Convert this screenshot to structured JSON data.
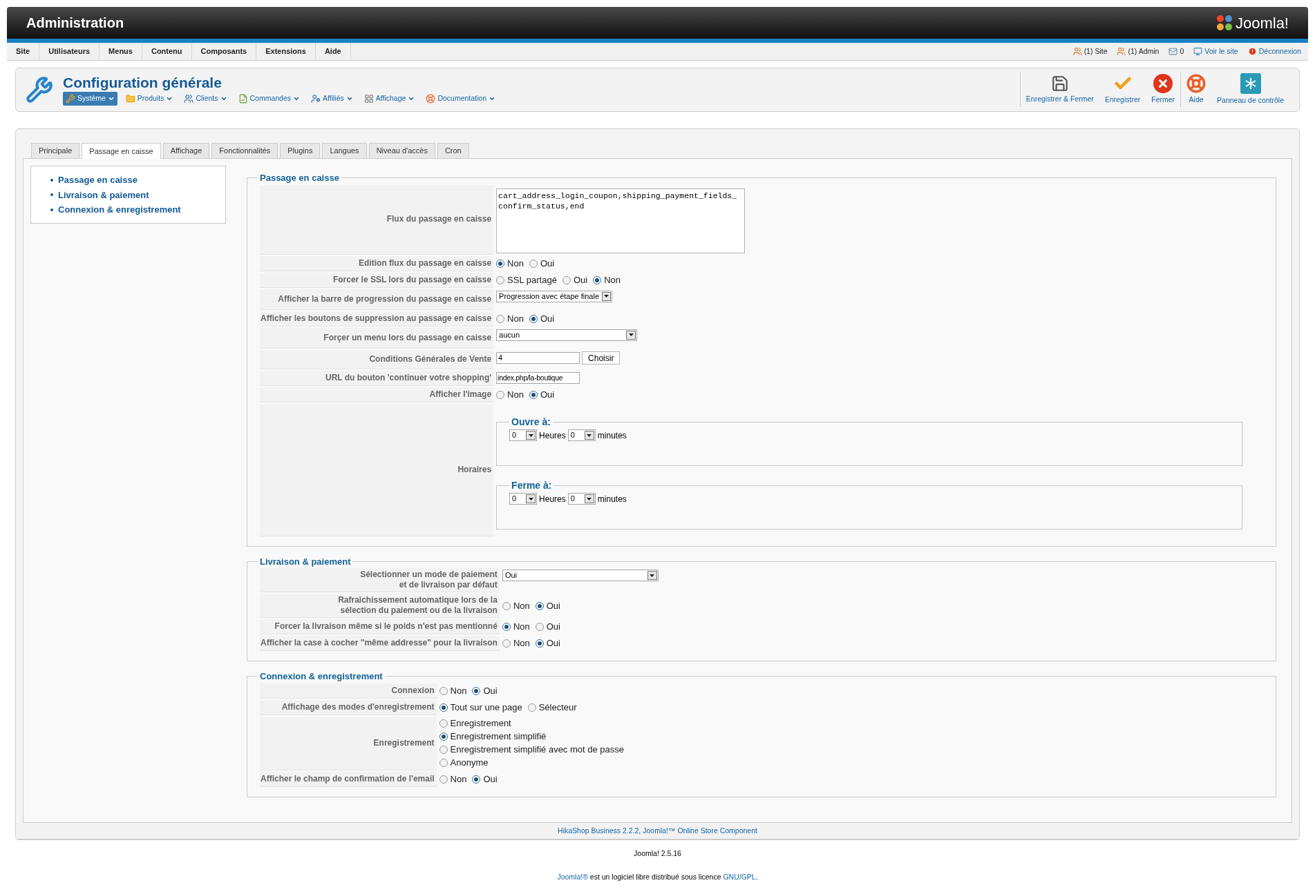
{
  "header": {
    "title": "Administration",
    "logo_text": "Joomla!"
  },
  "menu": [
    {
      "label": "Site"
    },
    {
      "label": "Utilisateurs"
    },
    {
      "label": "Menus"
    },
    {
      "label": "Contenu"
    },
    {
      "label": "Composants"
    },
    {
      "label": "Extensions"
    },
    {
      "label": "Aide"
    }
  ],
  "status": [
    {
      "kind": "users",
      "label": "(1) Site"
    },
    {
      "kind": "users",
      "label": "(1) Admin"
    },
    {
      "kind": "mail",
      "label": "0"
    },
    {
      "kind": "view",
      "label": "Voir le site"
    },
    {
      "kind": "logout",
      "label": "Déconnexion"
    }
  ],
  "toolbar": {
    "title": "Configuration générale",
    "submenu": [
      {
        "kind": "system",
        "label": "Système",
        "selected": true
      },
      {
        "kind": "products",
        "label": "Produits",
        "selected": false
      },
      {
        "kind": "clients",
        "label": "Clients",
        "selected": false
      },
      {
        "kind": "orders",
        "label": "Commandes",
        "selected": false
      },
      {
        "kind": "affiliates",
        "label": "Affiliés",
        "selected": false
      },
      {
        "kind": "display",
        "label": "Affichage",
        "selected": false
      },
      {
        "kind": "help",
        "label": "Documentation",
        "selected": false
      }
    ],
    "actions": [
      {
        "kind": "save_close",
        "label": "Enregistrer & Fermer"
      },
      {
        "kind": "save",
        "label": "Enregistrer"
      },
      {
        "kind": "close",
        "label": "Fermer"
      },
      {
        "kind": "help",
        "label": "Aide"
      },
      {
        "kind": "panel",
        "label": "Panneau de contrôle"
      }
    ]
  },
  "tabs": [
    {
      "label": "Principale",
      "selected": false
    },
    {
      "label": "Passage en caisse",
      "selected": true
    },
    {
      "label": "Affichage",
      "selected": false
    },
    {
      "label": "Fonctionnalités",
      "selected": false
    },
    {
      "label": "Plugins",
      "selected": false
    },
    {
      "label": "Langues",
      "selected": false
    },
    {
      "label": "Niveau d'accès",
      "selected": false
    },
    {
      "label": "Cron",
      "selected": false
    }
  ],
  "sidebar": {
    "items": [
      "Passage en caisse",
      "Livraison & paiement",
      "Connexion & enregistrement"
    ]
  },
  "sections": [
    {
      "title": "Passage en caisse",
      "fields": [
        {
          "kind": "textarea",
          "label": "Flux du passage en caisse",
          "value": "cart_address_login_coupon,shipping_payment_fields_\nconfirm_status,end"
        },
        {
          "kind": "radio",
          "label": "Edition flux du passage en caisse",
          "options": [
            {
              "label": "Non",
              "selected": true
            },
            {
              "label": "Oui",
              "selected": false
            }
          ]
        },
        {
          "kind": "radio",
          "label": "Forcer le SSL lors du passage en caisse",
          "options": [
            {
              "label": "SSL partagé",
              "selected": false
            },
            {
              "label": "Oui",
              "selected": false
            },
            {
              "label": "Non",
              "selected": true
            }
          ]
        },
        {
          "kind": "select",
          "label": "Afficher la barre de progression du passage en caisse",
          "value": "Progression avec étape finale"
        },
        {
          "kind": "radio",
          "label": "Afficher les boutons de suppression au passage en caisse",
          "options": [
            {
              "label": "Non",
              "selected": false
            },
            {
              "label": "Oui",
              "selected": true
            }
          ]
        },
        {
          "kind": "select",
          "label": "Forçer un menu lors du passage en caisse",
          "value": "aucun"
        },
        {
          "kind": "text_button",
          "label": "Conditions Générales de Vente",
          "value": "4",
          "button": "Choisir"
        },
        {
          "kind": "text",
          "label": "URL du bouton 'continuer votre shopping'",
          "value": "index.php/la-boutique"
        },
        {
          "kind": "radio",
          "label": "Afficher l'image",
          "options": [
            {
              "label": "Non",
              "selected": false
            },
            {
              "label": "Oui",
              "selected": true
            }
          ]
        },
        {
          "kind": "schedule",
          "label": "Horaires",
          "groups": [
            {
              "title": "Ouvre à:",
              "hours": "0",
              "hours_label": "Heures",
              "minutes": "0",
              "minutes_label": "minutes"
            },
            {
              "title": "Ferme à:",
              "hours": "0",
              "hours_label": "Heures",
              "minutes": "0",
              "minutes_label": "minutes"
            }
          ]
        }
      ]
    },
    {
      "title": "Livraison & paiement",
      "fields": [
        {
          "kind": "select",
          "label": "Sélectionner un mode de paiement\net de livraison par défaut",
          "value": "Oui"
        },
        {
          "kind": "radio",
          "label": "Rafraîchissement automatique lors de la\nsélection du paiement ou de la livraison",
          "options": [
            {
              "label": "Non",
              "selected": false
            },
            {
              "label": "Oui",
              "selected": true
            }
          ]
        },
        {
          "kind": "radio",
          "label": "Forcer la livraison même si le poids n'est pas mentionné",
          "options": [
            {
              "label": "Non",
              "selected": true
            },
            {
              "label": "Oui",
              "selected": false
            }
          ]
        },
        {
          "kind": "radio",
          "label": "Afficher la case à cocher \"même addresse\" pour la livraison",
          "options": [
            {
              "label": "Non",
              "selected": false
            },
            {
              "label": "Oui",
              "selected": true
            }
          ]
        }
      ]
    },
    {
      "title": "Connexion & enregistrement",
      "fields": [
        {
          "kind": "radio",
          "label": "Connexion",
          "options": [
            {
              "label": "Non",
              "selected": false
            },
            {
              "label": "Oui",
              "selected": true
            }
          ]
        },
        {
          "kind": "radio",
          "label": "Affichage des modes d'enregistrement",
          "options": [
            {
              "label": "Tout sur une page",
              "selected": true
            },
            {
              "label": "Sélecteur",
              "selected": false
            }
          ]
        },
        {
          "kind": "radio_list",
          "label": "Enregistrement",
          "options": [
            {
              "label": "Enregistrement",
              "selected": false
            },
            {
              "label": "Enregistrement simplifié",
              "selected": true
            },
            {
              "label": "Enregistrement simplifié avec mot de passe",
              "selected": false
            },
            {
              "label": "Anonyme",
              "selected": false
            }
          ]
        },
        {
          "kind": "radio",
          "label": "Afficher le champ de confirmation de l'email",
          "options": [
            {
              "label": "Non",
              "selected": false
            },
            {
              "label": "Oui",
              "selected": true
            }
          ]
        }
      ]
    }
  ],
  "component_footer": "HikaShop Business 2.2.2, Joomla!™ Online Store Component",
  "version": "Joomla! 2.5.16",
  "license": [
    {
      "kind": "link",
      "text": "Joomla!®"
    },
    {
      "kind": "text",
      "text": " est un logiciel libre distribué sous licence "
    },
    {
      "kind": "link",
      "text": "GNU/GPL"
    },
    {
      "kind": "text",
      "text": "."
    }
  ]
}
